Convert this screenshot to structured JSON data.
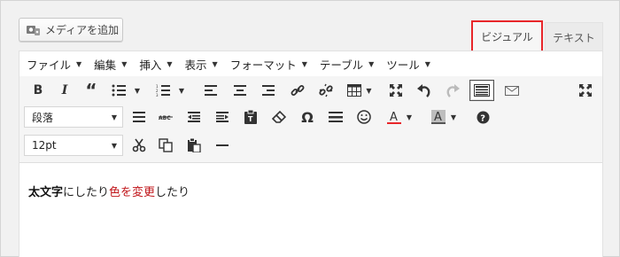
{
  "media_button": {
    "label": "メディアを追加",
    "icon": "media-camera-icon"
  },
  "tabs": {
    "visual": "ビジュアル",
    "text": "テキスト"
  },
  "menu": [
    "ファイル",
    "編集",
    "挿入",
    "表示",
    "フォーマット",
    "テーブル",
    "ツール"
  ],
  "format_select": {
    "value": "段落"
  },
  "size_select": {
    "value": "12pt"
  },
  "content": {
    "bold": "太文字",
    "plain1": "にしたり",
    "red": "色を変更",
    "plain2": "したり"
  },
  "colors": {
    "highlight_tab_border": "#e8262a",
    "text_red": "#c0151a",
    "text_color_underline": "#e8262a",
    "bg_color_swatch": "#888888"
  }
}
